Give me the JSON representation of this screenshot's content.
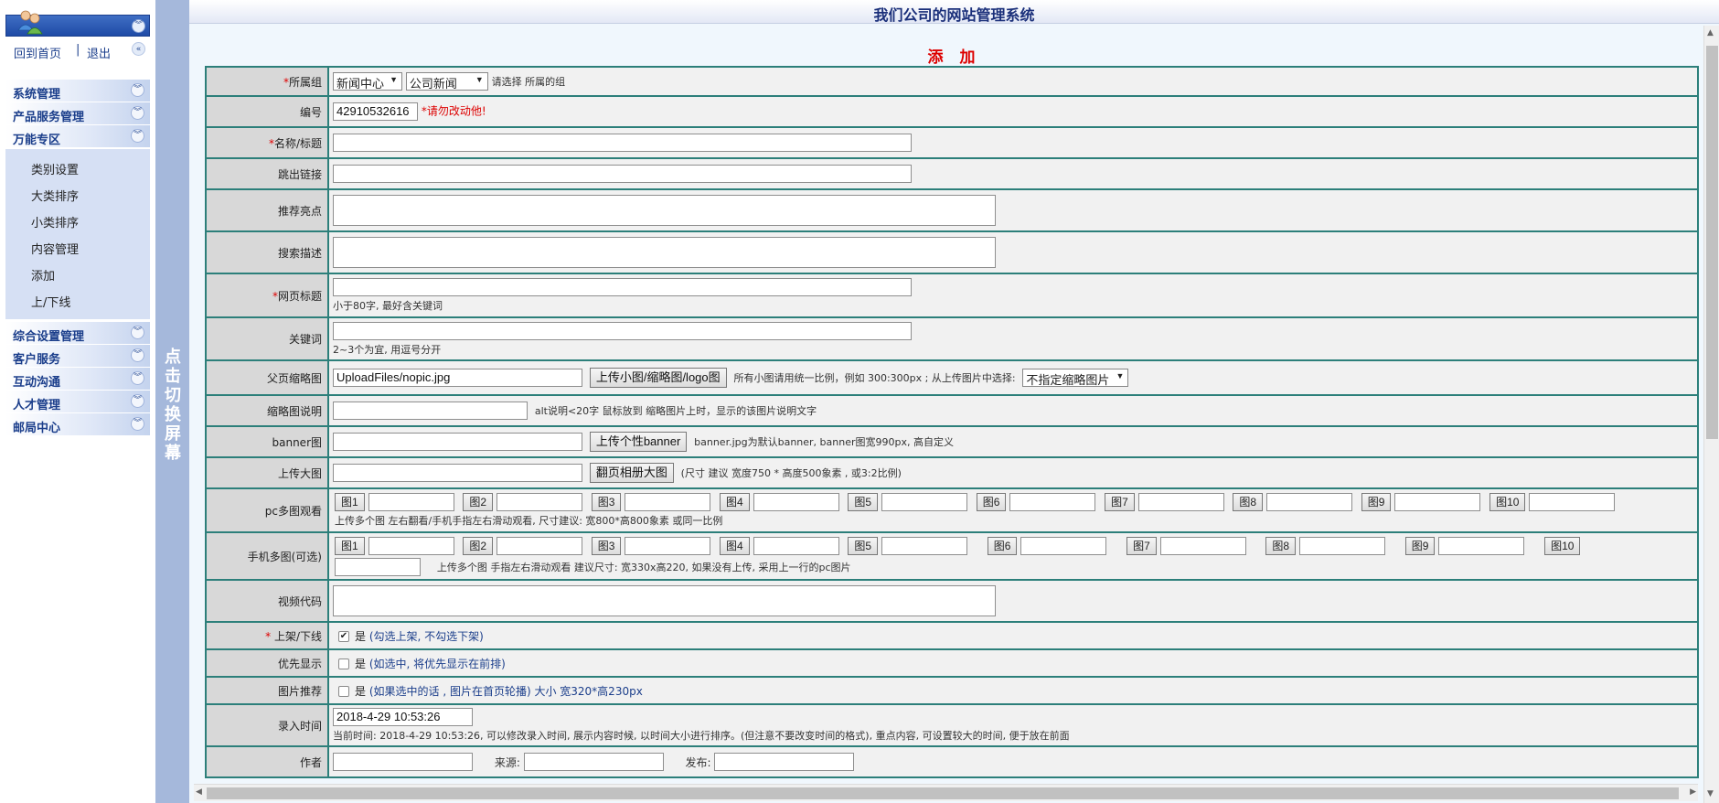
{
  "app_title": "我们公司的网站管理系统",
  "form_title": "添 加",
  "sidebar": {
    "home_link": "回到首页",
    "separator": "|",
    "logout_link": "退出",
    "groups": [
      {
        "label": "系统管理"
      },
      {
        "label": "产品服务管理"
      },
      {
        "label": "万能专区"
      },
      {
        "label": "综合设置管理"
      },
      {
        "label": "客户服务"
      },
      {
        "label": "互动沟通"
      },
      {
        "label": "人才管理"
      },
      {
        "label": "邮局中心"
      }
    ],
    "sub_items": [
      "类别设置",
      "大类排序",
      "小类排序",
      "内容管理",
      "添加",
      "上/下线"
    ]
  },
  "toggle_text": "点击切换屏幕",
  "form": {
    "group": {
      "label": "所属组",
      "select1": "新闻中心",
      "select2": "公司新闻",
      "hint": "请选择 所属的组"
    },
    "code": {
      "label": "编号",
      "value": "42910532616",
      "warn": "*请勿改动他!"
    },
    "name": {
      "label": "名称/标题"
    },
    "jump": {
      "label": "跳出链接"
    },
    "highlight": {
      "label": "推荐亮点"
    },
    "desc": {
      "label": "搜索描述"
    },
    "pagetitle": {
      "label": "网页标题",
      "hint": "小于80字, 最好含关键词"
    },
    "keywords": {
      "label": "关键词",
      "hint": "2~3个为宜, 用逗号分开"
    },
    "thumb": {
      "label": "父页缩略图",
      "value": "UploadFiles/nopic.jpg",
      "button": "上传小图/缩略图/logo图",
      "hint": "所有小图请用统一比例，例如 300:300px ; 从上传图片中选择:",
      "select": "不指定缩略图片"
    },
    "thumbdesc": {
      "label": "缩略图说明",
      "hint": "alt说明<20字 鼠标放到 缩略图片上时，显示的该图片说明文字"
    },
    "banner": {
      "label": "banner图",
      "button": "上传个性banner",
      "hint": "banner.jpg为默认banner, banner图宽990px, 高自定义"
    },
    "bigpic": {
      "label": "上传大图",
      "button": "翻页相册大图",
      "hint": "(尺寸 建议 宽度750 * 高度500象素 , 或3:2比例)"
    },
    "pcmulti": {
      "label": "pc多图观看",
      "buttons": [
        "图1",
        "图2",
        "图3",
        "图4",
        "图5",
        "图6",
        "图7",
        "图8",
        "图9",
        "图10"
      ],
      "hint": "上传多个图 左右翻看/手机手指左右滑动观看, 尺寸建议: 宽800*高800象素 或同一比例"
    },
    "mobmulti": {
      "label": "手机多图(可选)",
      "buttons": [
        "图1",
        "图2",
        "图3",
        "图4",
        "图5",
        "图6",
        "图7",
        "图8",
        "图9",
        "图10"
      ],
      "hint": "上传多个图 手指左右滑动观看 建议尺寸: 宽330x高220, 如果没有上传, 采用上一行的pc图片"
    },
    "video": {
      "label": "视频代码"
    },
    "online": {
      "label": "上架/下线",
      "checked": true,
      "yes": "是",
      "note": "(勾选上架, 不勾选下架)"
    },
    "priority": {
      "label": "优先显示",
      "checked": false,
      "yes": "是",
      "note": "(如选中, 将优先显示在前排)"
    },
    "recommend": {
      "label": "图片推荐",
      "checked": false,
      "yes": "是",
      "note": "(如果选中的话 , 图片在首页轮播) 大小 宽320*高230px"
    },
    "entrytime": {
      "label": "录入时间",
      "value": "2018-4-29 10:53:26",
      "hint": "当前时间: 2018-4-29 10:53:26, 可以修改录入时间, 展示内容时候, 以时间大小进行排序。(但注意不要改变时间的格式), 重点内容, 可设置较大的时间, 便于放在前面"
    },
    "author": {
      "label": "作者",
      "source_label": "来源:",
      "publish_label": "发布:"
    }
  }
}
